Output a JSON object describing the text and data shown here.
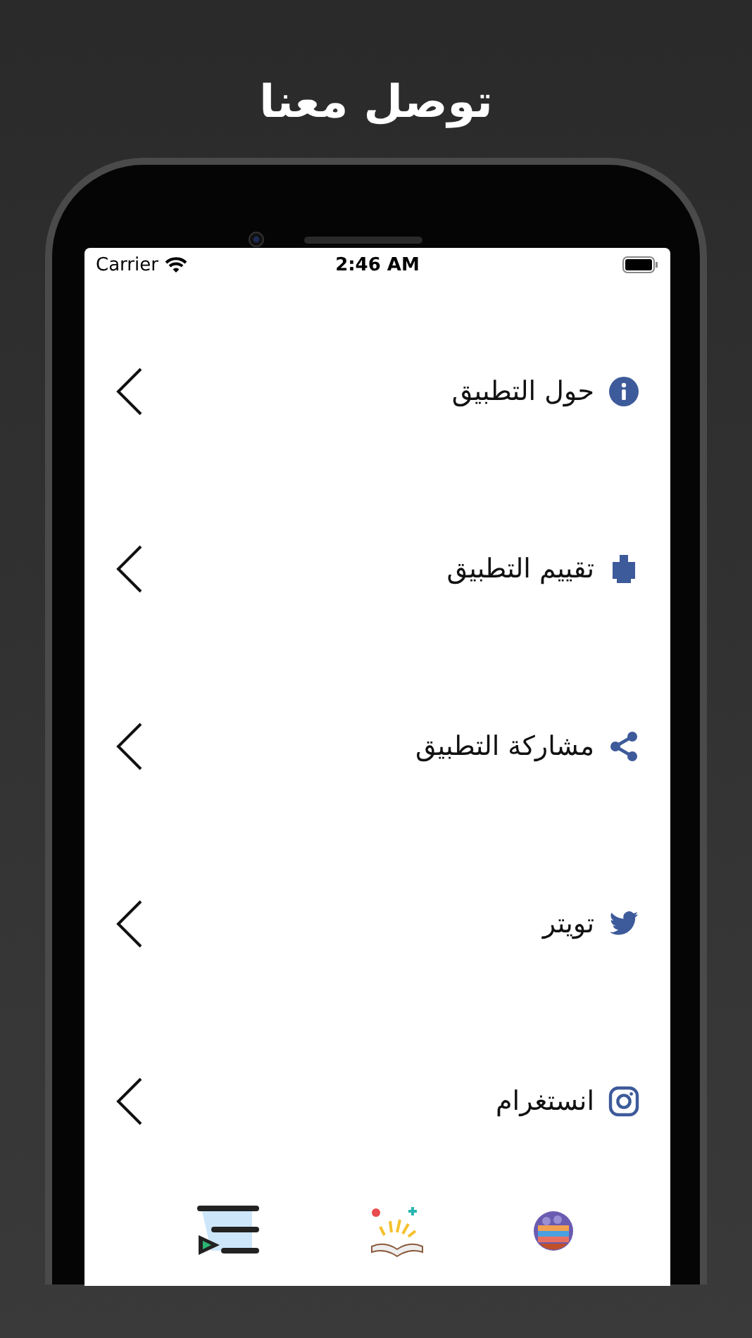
{
  "title": "توصل معنا",
  "status_bar": {
    "carrier": "Carrier",
    "time": "2:46 AM"
  },
  "menu_items": [
    {
      "label": "حول التطبيق",
      "kind": "info"
    },
    {
      "label": "تقييم التطبيق",
      "kind": "rate"
    },
    {
      "label": "مشاركة التطبيق",
      "kind": "share"
    },
    {
      "label": "تويتر",
      "kind": "twitter"
    },
    {
      "label": "انستغرام",
      "kind": "instagram"
    }
  ]
}
